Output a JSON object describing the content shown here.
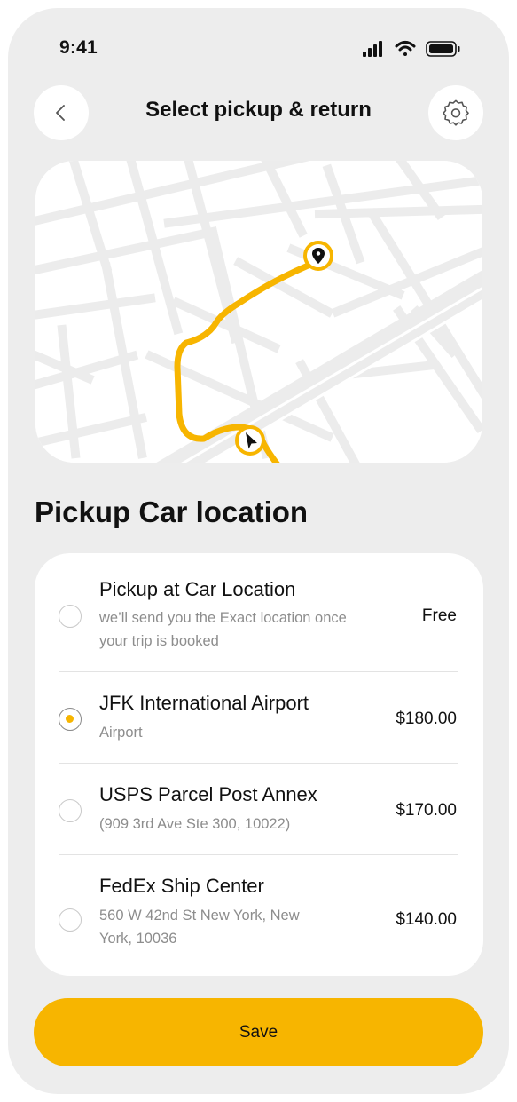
{
  "status_bar": {
    "time": "9:41",
    "icons": [
      "cellular-signal-icon",
      "wifi-icon",
      "battery-icon"
    ]
  },
  "header": {
    "title": "Select pickup & return",
    "back_icon": "chevron-left-icon",
    "settings_icon": "gear-icon"
  },
  "map": {
    "route_color": "#f7b500",
    "street_color": "#ececec",
    "destination_icon": "map-pin-icon",
    "origin_icon": "navigation-cursor-icon"
  },
  "section": {
    "title": "Pickup Car location"
  },
  "options": [
    {
      "title": "Pickup at Car Location",
      "subtitle": "we’ll send you the Exact location once your trip is booked",
      "price": "Free",
      "selected": false
    },
    {
      "title": "JFK International Airport",
      "subtitle": "Airport",
      "price": "$180.00",
      "selected": true
    },
    {
      "title": "USPS Parcel Post Annex",
      "subtitle": "(909 3rd Ave Ste 300, 10022)",
      "price": "$170.00",
      "selected": false
    },
    {
      "title": "FedEx Ship Center",
      "subtitle": "560 W 42nd St New York, New York, 10036",
      "price": "$140.00",
      "selected": false
    }
  ],
  "actions": {
    "save_label": "Save"
  },
  "colors": {
    "accent": "#f7b500",
    "background": "#ededed",
    "surface": "#ffffff"
  }
}
